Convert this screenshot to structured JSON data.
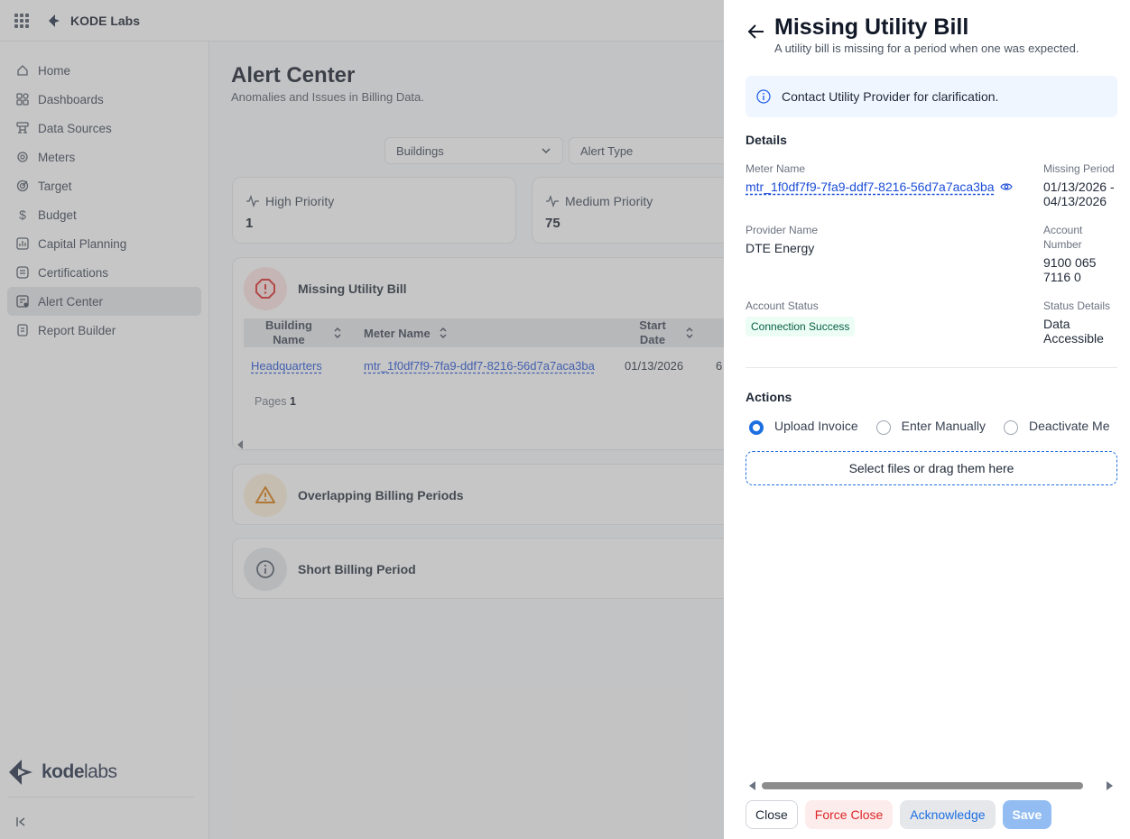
{
  "topbar": {
    "org_name": "KODE Labs"
  },
  "sidebar": {
    "items": [
      {
        "label": "Home",
        "icon": "home-icon"
      },
      {
        "label": "Dashboards",
        "icon": "dashboards-icon"
      },
      {
        "label": "Data Sources",
        "icon": "data-sources-icon"
      },
      {
        "label": "Meters",
        "icon": "meters-icon"
      },
      {
        "label": "Target",
        "icon": "target-icon"
      },
      {
        "label": "Budget",
        "icon": "dollar-icon"
      },
      {
        "label": "Capital Planning",
        "icon": "chart-icon"
      },
      {
        "label": "Certifications",
        "icon": "certifications-icon"
      },
      {
        "label": "Alert Center",
        "icon": "alert-center-icon",
        "active": true
      },
      {
        "label": "Report Builder",
        "icon": "report-icon"
      }
    ],
    "brand": {
      "bold": "kode",
      "light": "labs"
    }
  },
  "main": {
    "title": "Alert Center",
    "subtitle": "Anomalies and Issues in Billing Data.",
    "filters": {
      "buildings": "Buildings",
      "alert_type": "Alert Type"
    },
    "stats": [
      {
        "label": "High Priority",
        "value": "1"
      },
      {
        "label": "Medium Priority",
        "value": "75"
      }
    ],
    "alerts": {
      "missing": {
        "name": "Missing Utility Bill",
        "columns": {
          "building": "Building Name",
          "meter": "Meter Name",
          "start": "Start Date"
        },
        "row": {
          "building": "Headquarters",
          "meter": "mtr_1f0df7f9-7fa9-ddf7-8216-56d7a7aca3ba",
          "start": "01/13/2026",
          "next": "6"
        },
        "pages_label": "Pages",
        "pages_value": "1"
      },
      "overlapping": {
        "name": "Overlapping Billing Periods"
      },
      "short": {
        "name": "Short Billing Period"
      }
    }
  },
  "drawer": {
    "title": "Missing Utility Bill",
    "subtitle": "A utility bill is missing for a period when one was expected.",
    "info": "Contact Utility Provider for clarification.",
    "details_heading": "Details",
    "fields": {
      "meter_name_label": "Meter Name",
      "meter_name_value": "mtr_1f0df7f9-7fa9-ddf7-8216-56d7a7aca3ba",
      "missing_period_label": "Missing Period",
      "missing_period_line1": "01/13/2026 -",
      "missing_period_line2": "04/13/2026",
      "provider_label": "Provider Name",
      "provider_value": "DTE Energy",
      "account_number_label_1": "Account",
      "account_number_label_2": "Number",
      "account_number_line1": "9100 065",
      "account_number_line2": "7116 0",
      "account_status_label": "Account Status",
      "account_status_value": "Connection Success",
      "status_details_label": "Status Details",
      "status_details_line1": "Data",
      "status_details_line2": "Accessible"
    },
    "actions_heading": "Actions",
    "actions": [
      {
        "label": "Upload Invoice",
        "selected": true
      },
      {
        "label": "Enter Manually",
        "selected": false
      },
      {
        "label": "Deactivate Me",
        "selected": false
      }
    ],
    "dropzone": "Select files or drag them here",
    "buttons": {
      "close": "Close",
      "force_close": "Force Close",
      "acknowledge": "Acknowledge",
      "save": "Save"
    }
  },
  "colors": {
    "accent": "#1d6fe0",
    "danger": "#dc2626",
    "warning": "#d97706"
  }
}
